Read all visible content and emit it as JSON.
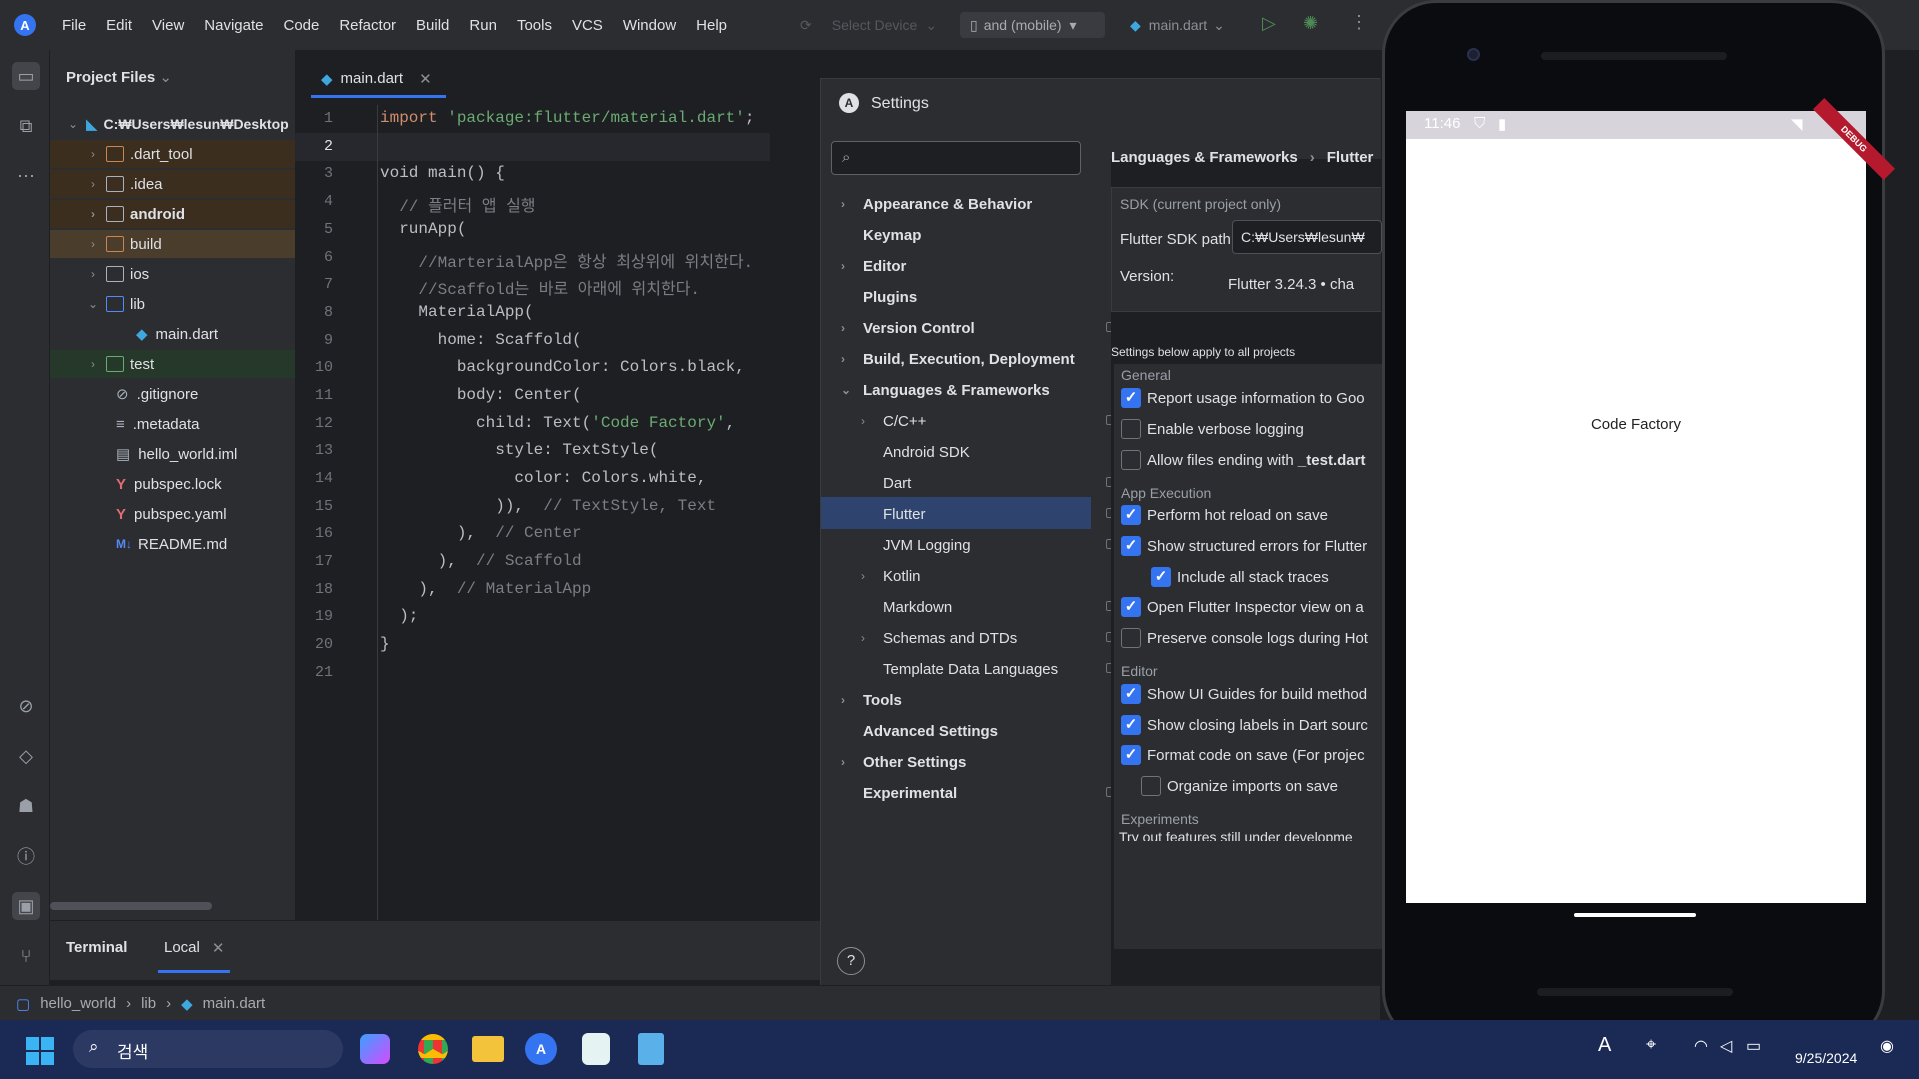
{
  "menubar": {
    "app_logo": "A",
    "items": [
      "File",
      "Edit",
      "View",
      "Navigate",
      "Code",
      "Refactor",
      "Build",
      "Run",
      "Tools",
      "VCS",
      "Window",
      "Help"
    ],
    "device_selector": "Select Device",
    "device_target": "and (mobile)",
    "run_config": "main.dart"
  },
  "project": {
    "header": "Project Files",
    "root": "C:₩Users₩lesun₩Desktop",
    "items": [
      ".dart_tool",
      ".idea",
      "android",
      "build",
      "ios",
      "lib",
      "main.dart",
      "test",
      ".gitignore",
      ".metadata",
      "hello_world.iml",
      "pubspec.lock",
      "pubspec.yaml",
      "README.md"
    ]
  },
  "editor": {
    "tab": "main.dart",
    "lines": [
      "1",
      "2",
      "3",
      "4",
      "5",
      "6",
      "7",
      "8",
      "9",
      "10",
      "11",
      "12",
      "13",
      "14",
      "15",
      "16",
      "17",
      "18",
      "19",
      "20",
      "21"
    ],
    "code": {
      "l1a": "import ",
      "l1b": "'package:flutter/material.dart'",
      "l1c": ";",
      "l3": "void main() {",
      "l4": "  // 플러터 앱 실행",
      "l5": "  runApp(",
      "l6": "    //MarterialApp은 항상 최상위에 위치한다.",
      "l7": "    //Scaffold는 바로 아래에 위치한다.",
      "l8": "    MaterialApp(",
      "l9": "      home: Scaffold(",
      "l10": "        backgroundColor: Colors.black,",
      "l11": "        body: Center(",
      "l12a": "          child: Text(",
      "l12b": "'Code Factory'",
      "l12c": ",",
      "l13": "            style: TextStyle(",
      "l14": "              color: Colors.white,",
      "l15a": "            )),  ",
      "l15b": "// TextStyle, Text",
      "l16a": "        ),  ",
      "l16b": "// Center",
      "l17a": "      ),  ",
      "l17b": "// Scaffold",
      "l18a": "    ),  ",
      "l18b": "// MaterialApp",
      "l19": "  );",
      "l20": "}"
    }
  },
  "settings": {
    "title": "Settings",
    "tree": [
      "Appearance & Behavior",
      "Keymap",
      "Editor",
      "Plugins",
      "Version Control",
      "Build, Execution, Deployment",
      "Languages & Frameworks",
      "C/C++",
      "Android SDK",
      "Dart",
      "Flutter",
      "JVM Logging",
      "Kotlin",
      "Markdown",
      "Schemas and DTDs",
      "Template Data Languages",
      "Tools",
      "Advanced Settings",
      "Other Settings",
      "Experimental"
    ],
    "breadcrumb_a": "Languages & Frameworks",
    "breadcrumb_b": "Flutter",
    "sdk_header": "SDK (current project only)",
    "sdk_label": "Flutter SDK path:",
    "sdk_value": "C:₩Users₩lesun₩",
    "version_label": "Version:",
    "version_value": "Flutter 3.24.3 • cha",
    "apply_note": "Settings below apply to all projects",
    "general": "General",
    "g1": "Report usage information to Goo",
    "g2": "Enable verbose logging",
    "g3a": "Allow files ending with ",
    "g3b": "_test.dart",
    "app_exec": "App Execution",
    "a1": "Perform hot reload on save",
    "a2": "Show structured errors for Flutter",
    "a3": "Include all stack traces",
    "a4": "Open Flutter Inspector view on a",
    "a5": "Preserve console logs during Hot",
    "editor": "Editor",
    "e1": "Show UI Guides for build method",
    "e2": "Show closing labels in Dart sourc",
    "e3": "Format code on save   (For projec",
    "e4": "Organize imports on save",
    "experiments": "Experiments",
    "exp_note": "Try out features still under developme",
    "help": "?"
  },
  "phone": {
    "time": "11:46",
    "debug": "DEBUG",
    "text": "Code Factory"
  },
  "bottom": {
    "terminal": "Terminal",
    "local": "Local"
  },
  "breadcrumb": {
    "a": "hello_world",
    "b": "lib",
    "c": "main.dart"
  },
  "taskbar": {
    "search": "검색",
    "date": "9/25/2024"
  }
}
